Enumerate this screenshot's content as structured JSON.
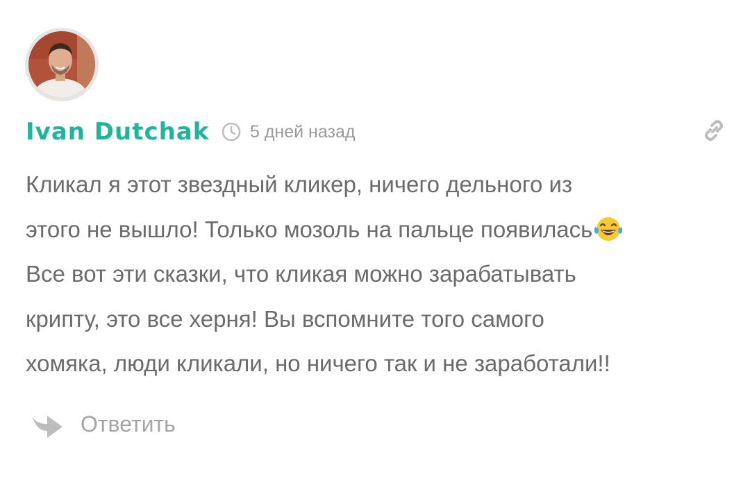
{
  "comment": {
    "author": "Ivan Dutchak",
    "timestamp": "5 дней назад",
    "text_lines": [
      "Кликал я этот звездный кликер, ничего дельного из",
      "этого не вышло! Только мозоль на пальце появилась",
      "Все вот эти сказки, что кликая можно зарабатывать",
      "крипту, это все херня! Вы вспомните того самого",
      "хомяка, люди кликали, но ничего так и не заработали!!"
    ],
    "emoji": "😂",
    "reply_label": "Ответить"
  },
  "icons": {
    "avatar": "avatar-photo",
    "clock": "clock-icon",
    "link": "link-icon",
    "reply": "reply-arrow-icon"
  },
  "colors": {
    "author": "#1fb59a",
    "text": "#6b6b6b",
    "meta": "#9a9a9a",
    "icon": "#bdbdbd"
  }
}
